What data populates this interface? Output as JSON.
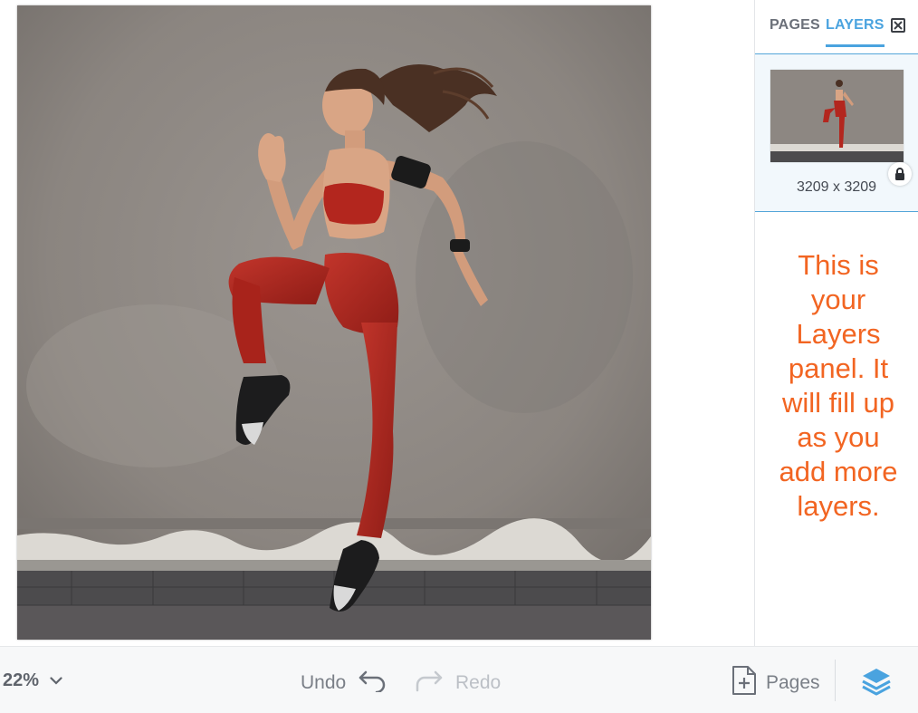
{
  "canvas": {
    "image_alt": "Woman in red sportswear jumping against a concrete wall"
  },
  "panel": {
    "tabs": [
      {
        "label": "PAGES",
        "active": false
      },
      {
        "label": "LAYERS",
        "active": true
      }
    ],
    "close_icon": "close-icon",
    "layer": {
      "dimensions": "3209 x 3209",
      "locked": true,
      "lock_icon": "lock-icon"
    },
    "hint": "This is your Layers panel. It will fill up as you add more layers."
  },
  "toolbar": {
    "zoom": "22%",
    "zoom_icon": "chevron-down-icon",
    "undo_label": "Undo",
    "undo_icon": "undo-arrow-icon",
    "redo_label": "Redo",
    "redo_icon": "redo-arrow-icon",
    "redo_enabled": false,
    "pages_label": "Pages",
    "pages_icon": "add-page-icon",
    "layers_icon": "layers-stack-icon"
  },
  "colors": {
    "accent": "#4aa3df",
    "hint_text": "#f26522",
    "outfit_red": "#b3261e",
    "wall_grey": "#8d8782"
  }
}
